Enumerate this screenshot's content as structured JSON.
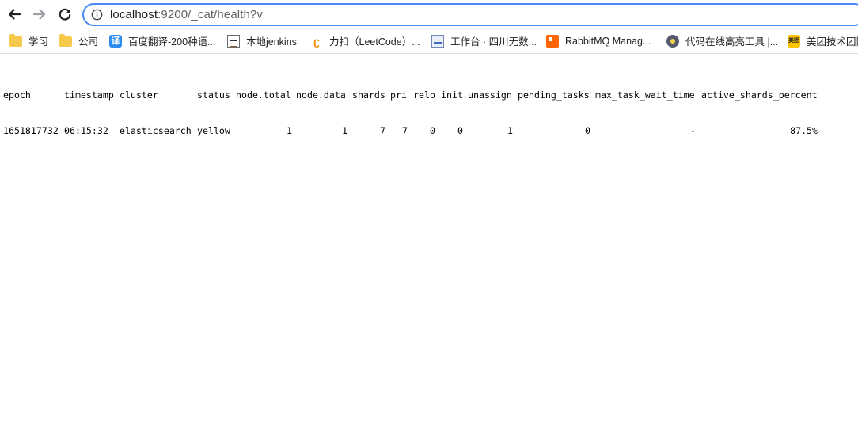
{
  "browser": {
    "url_host": "localhost",
    "url_rest": ":9200/_cat/health?v",
    "icons": {
      "back": "arrow-left-icon",
      "forward": "arrow-right-icon",
      "reload": "reload-icon",
      "site_info": "info-icon"
    },
    "colors": {
      "omnibox_border": "#4a8bf5",
      "text": "#202124"
    }
  },
  "bookmarks": [
    {
      "label": "学习",
      "icon": "folder-icon"
    },
    {
      "label": "公司",
      "icon": "folder-icon"
    },
    {
      "label": "百度翻译-200种语...",
      "icon": "translate-icon",
      "icon_text": "译"
    },
    {
      "label": "本地jenkins",
      "icon": "jenkins-icon"
    },
    {
      "label": "力扣（LeetCode）...",
      "icon": "leetcode-icon",
      "icon_text": "ʗ"
    },
    {
      "label": "工作台 · 四川无数...",
      "icon": "workbench-icon"
    },
    {
      "label": "RabbitMQ Manag...",
      "icon": "rabbitmq-icon"
    },
    {
      "label": "代码在线高亮工具 |...",
      "icon": "code-icon"
    },
    {
      "label": "美团技术团队",
      "icon": "meituan-icon",
      "icon_text": "美团"
    }
  ],
  "cat_health": {
    "headers": [
      "epoch",
      "timestamp",
      "cluster",
      "status",
      "node.total",
      "node.data",
      "shards",
      "pri",
      "relo",
      "init",
      "unassign",
      "pending_tasks",
      "max_task_wait_time",
      "active_shards_percent"
    ],
    "rows": [
      [
        "1651817732",
        "06:15:32",
        "elasticsearch",
        "yellow",
        "1",
        "1",
        "7",
        "7",
        "0",
        "0",
        "1",
        "0",
        "-",
        "87.5%"
      ]
    ]
  }
}
